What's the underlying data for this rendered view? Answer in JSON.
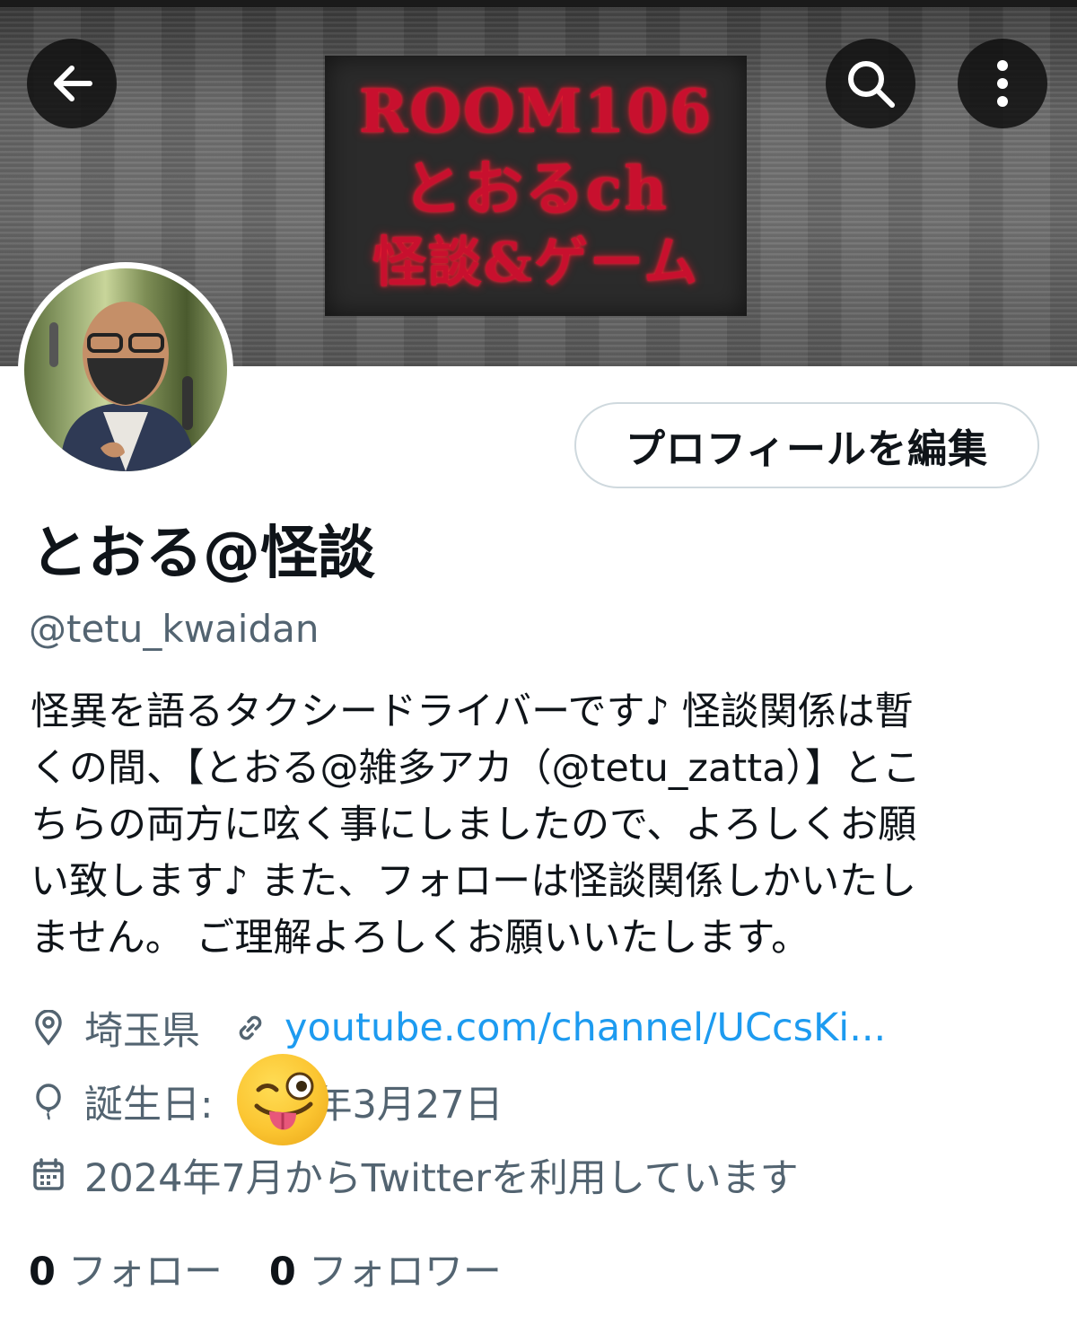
{
  "banner": {
    "line1": "ROOM106",
    "line2": "とおるch",
    "line3": "怪談&ゲーム"
  },
  "header": {
    "back_icon": "arrow-left-icon",
    "search_icon": "search-icon",
    "more_icon": "more-vertical-icon"
  },
  "profile": {
    "edit_button": "プロフィールを編集",
    "display_name": "とおる@怪談",
    "handle": "@tetu_kwaidan",
    "bio_lines": [
      "怪異を語るタクシードライバーです♪ 怪談関係は暫",
      "くの間、【とおる@雑多アカ（@tetu_zatta）】とこ",
      "ちらの両方に呟く事にしましたので、よろしくお願",
      "い致します♪ また、フォローは怪談関係しかいたし",
      "ません。 ご理解よろしくお願いいたします。"
    ],
    "location": "埼玉県",
    "link": "youtube.com/channel/UCcsKi...",
    "birthday_label": "誕生日:",
    "birthday_value": "年3月27日",
    "joined": "2024年7月からTwitterを利用しています",
    "following_count": "0",
    "following_label": "フォロー",
    "followers_count": "0",
    "followers_label": "フォロワー"
  },
  "colors": {
    "link": "#1d9bf0",
    "secondary_text": "#536471",
    "primary_text": "#0f1419",
    "banner_text": "#c8102e"
  }
}
